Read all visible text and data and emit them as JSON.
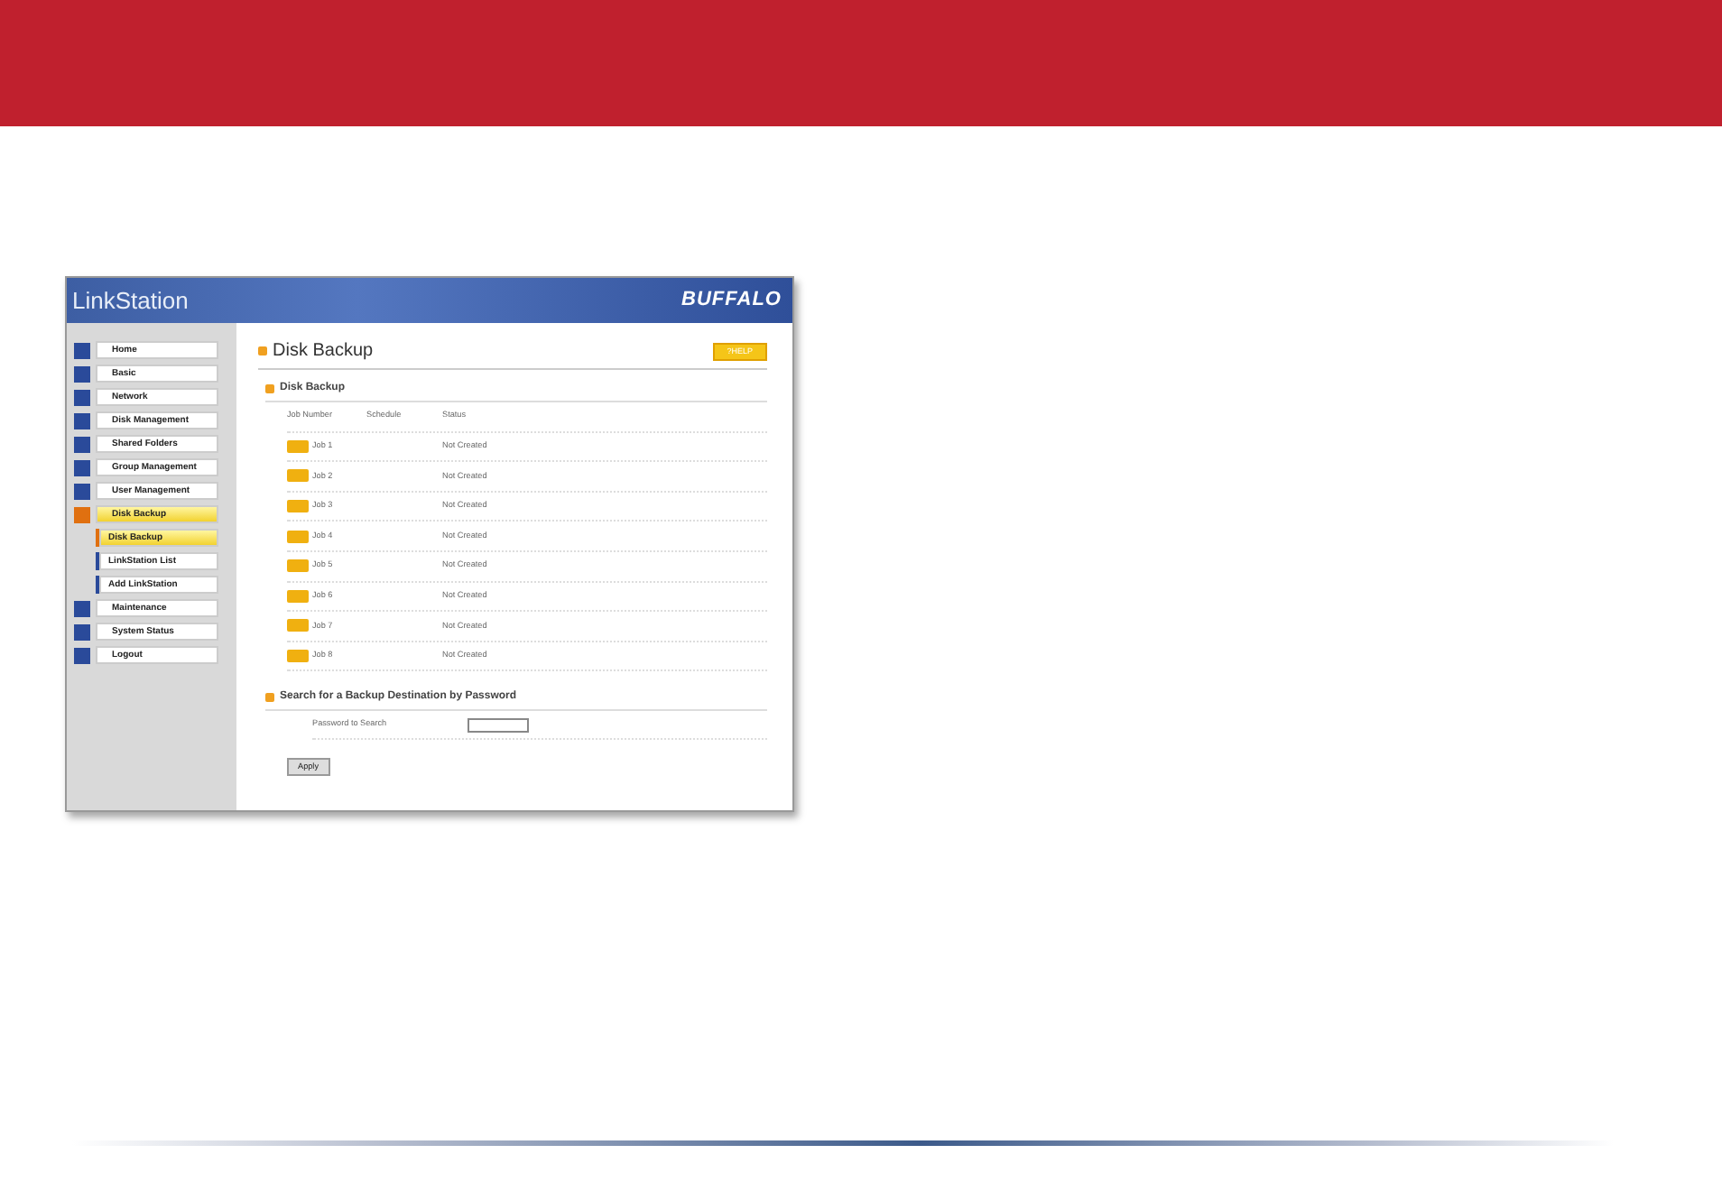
{
  "app_header": {
    "logo": "LinkStation",
    "brand": "BUFFALO"
  },
  "sidebar": {
    "items": [
      {
        "label": "Home",
        "selected": false
      },
      {
        "label": "Basic",
        "selected": false
      },
      {
        "label": "Network",
        "selected": false
      },
      {
        "label": "Disk Management",
        "selected": false
      },
      {
        "label": "Shared Folders",
        "selected": false
      },
      {
        "label": "Group Management",
        "selected": false
      },
      {
        "label": "User Management",
        "selected": false
      },
      {
        "label": "Disk Backup",
        "selected": true,
        "children": [
          {
            "label": "Disk Backup",
            "selected": true
          },
          {
            "label": "LinkStation List",
            "selected": false
          },
          {
            "label": "Add LinkStation",
            "selected": false
          }
        ]
      },
      {
        "label": "Maintenance",
        "selected": false
      },
      {
        "label": "System Status",
        "selected": false
      },
      {
        "label": "Logout",
        "selected": false
      }
    ]
  },
  "page_title": "Disk Backup",
  "help_button": "?HELP",
  "backup_section": {
    "title": "Disk Backup",
    "columns": [
      "Job Number",
      "Schedule",
      "Status"
    ],
    "rows": [
      {
        "job": "Job 1",
        "status": "Not Created"
      },
      {
        "job": "Job 2",
        "status": "Not Created"
      },
      {
        "job": "Job 3",
        "status": "Not Created"
      },
      {
        "job": "Job 4",
        "status": "Not Created"
      },
      {
        "job": "Job 5",
        "status": "Not Created"
      },
      {
        "job": "Job 6",
        "status": "Not Created"
      },
      {
        "job": "Job 7",
        "status": "Not Created"
      },
      {
        "job": "Job 8",
        "status": "Not Created"
      }
    ]
  },
  "search_section": {
    "title": "Search for a Backup Destination by Password",
    "field_label": "Password to Search"
  },
  "apply_button": "Apply"
}
